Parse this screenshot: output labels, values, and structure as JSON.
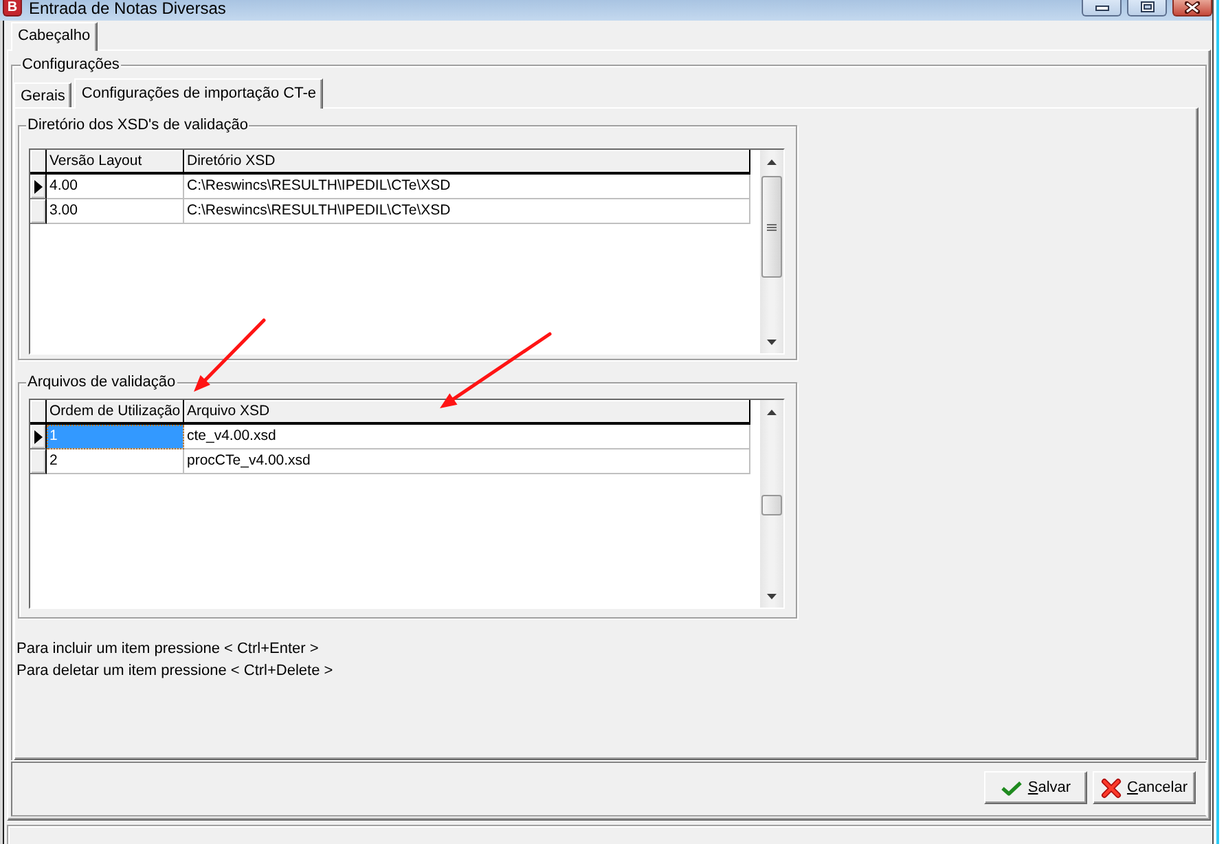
{
  "window": {
    "icon_letter": "B",
    "title": "Entrada de Notas Diversas"
  },
  "tabs": [
    {
      "label": "Cabeçalho",
      "selected": true
    }
  ],
  "settings_group": {
    "title": "Configurações",
    "tabs": [
      {
        "label": "Gerais",
        "selected": false
      },
      {
        "label": "Configurações de importação CT-e",
        "selected": true
      }
    ],
    "xsd_directories": {
      "title": "Diretório dos XSD's de validação",
      "columns": [
        "Versão Layout",
        "Diretório XSD"
      ],
      "rows": [
        {
          "selected": true,
          "cells": [
            {
              "text": "4.00",
              "selected": false
            },
            {
              "text": "C:\\Reswincs\\RESULTH\\IPEDIL\\CTe\\XSD",
              "selected": false
            }
          ]
        },
        {
          "selected": false,
          "cells": [
            {
              "text": "3.00",
              "selected": false
            },
            {
              "text": "C:\\Reswincs\\RESULTH\\IPEDIL\\CTe\\XSD",
              "selected": false
            }
          ]
        }
      ]
    },
    "validation_files": {
      "title": "Arquivos de validação",
      "columns": [
        "Ordem de Utilização",
        "Arquivo XSD"
      ],
      "rows": [
        {
          "selected": true,
          "cells": [
            {
              "text": "1",
              "selected": true
            },
            {
              "text": "cte_v4.00.xsd",
              "selected": false
            }
          ]
        },
        {
          "selected": false,
          "cells": [
            {
              "text": "2",
              "selected": false
            },
            {
              "text": "procCTe_v4.00.xsd",
              "selected": false
            }
          ]
        }
      ]
    },
    "hints": [
      "Para incluir um item pressione < Ctrl+Enter >",
      "Para deletar um item pressione < Ctrl+Delete >"
    ]
  },
  "buttons": [
    {
      "kind": "save",
      "label": "Salvar"
    },
    {
      "kind": "cancel",
      "label": "Cancelar"
    }
  ],
  "annotations": [
    {
      "kind": "arrow"
    },
    {
      "kind": "arrow"
    }
  ]
}
